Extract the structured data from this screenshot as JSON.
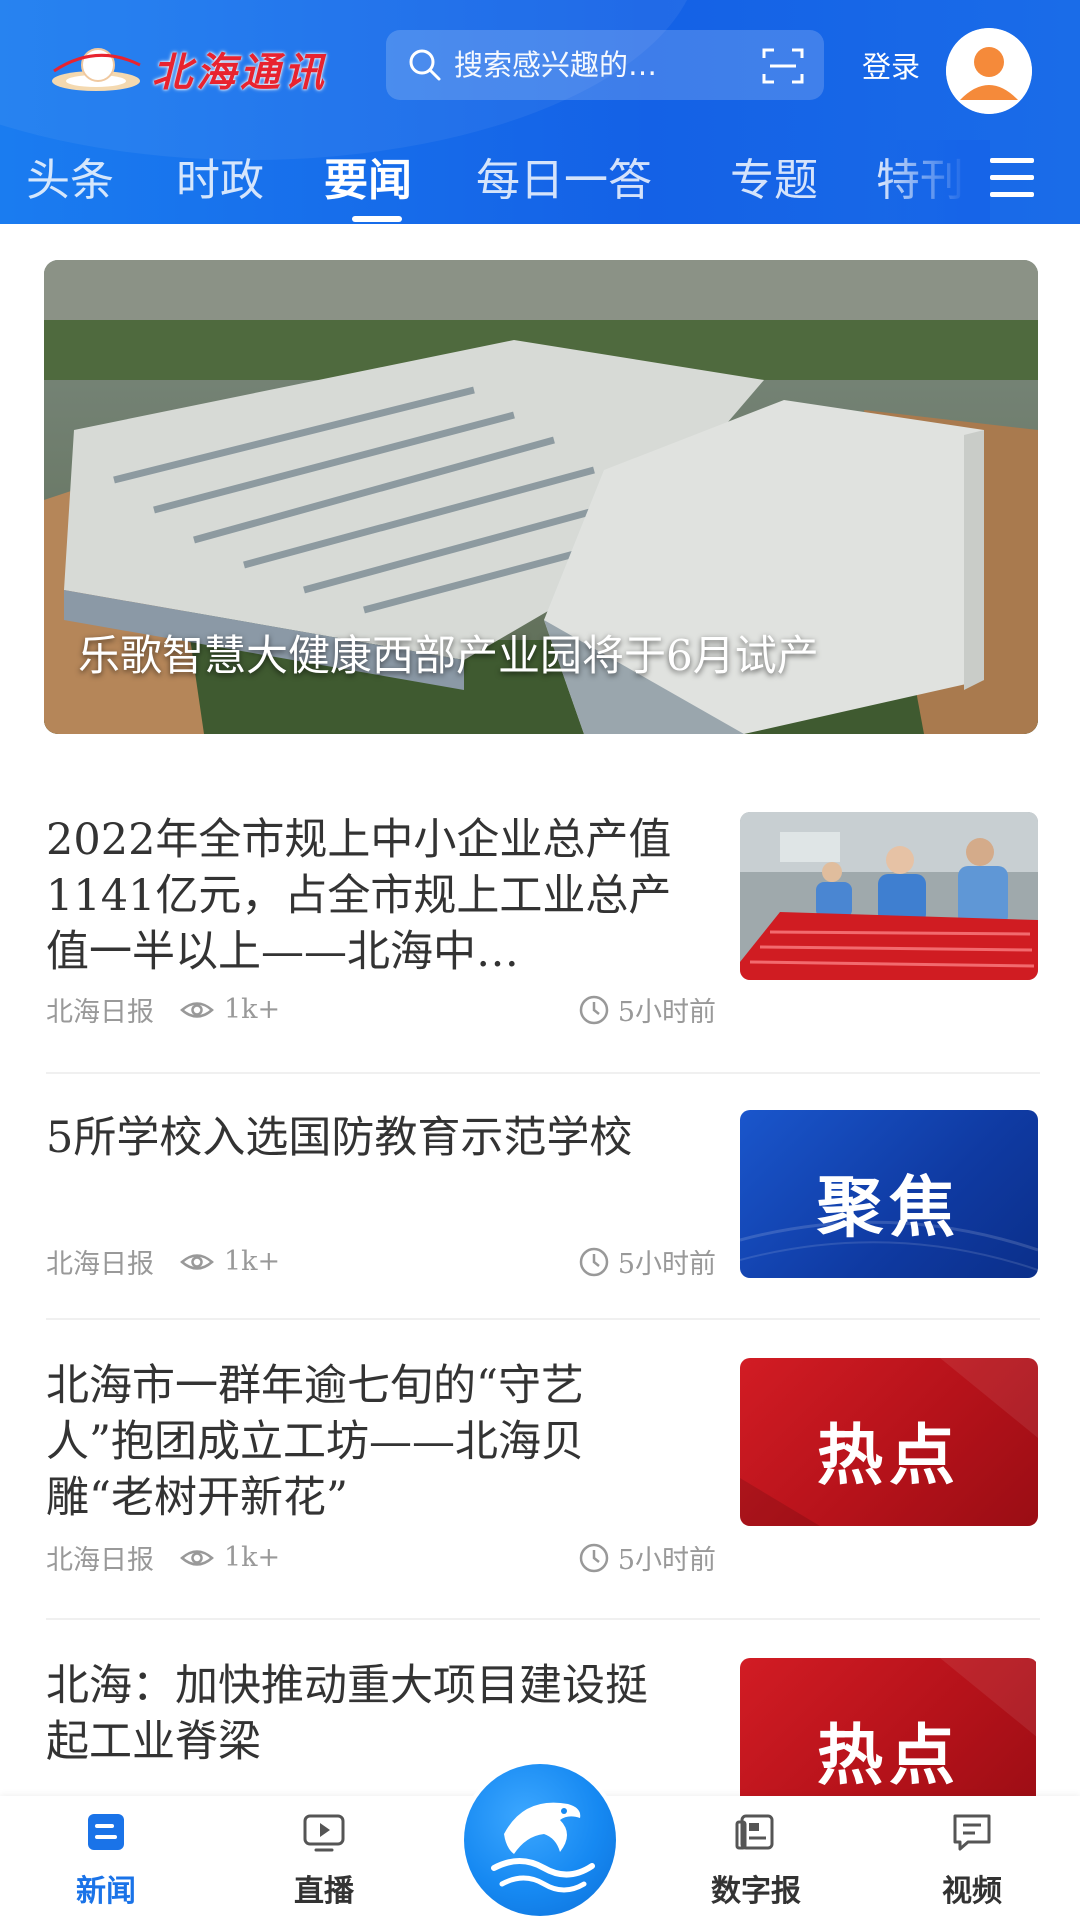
{
  "header": {
    "logo_text": "北海通讯",
    "search_placeholder": "搜索感兴趣的…",
    "login_label": "登录"
  },
  "tabs": [
    {
      "label": "头条"
    },
    {
      "label": "时政"
    },
    {
      "label": "要闻",
      "active": true
    },
    {
      "label": "每日一答"
    },
    {
      "label": "专题"
    },
    {
      "label": "特刊"
    }
  ],
  "hero": {
    "caption": "乐歌智慧大健康西部产业园将于6月试产"
  },
  "news": [
    {
      "title": "2022年全市规上中小企业总产值1141亿元，占全市规上工业总产值一半以上——北海中…",
      "source": "北海日报",
      "views": "1k+",
      "time": "5小时前",
      "thumb": "photo"
    },
    {
      "title": "5所学校入选国防教育示范学校",
      "source": "北海日报",
      "views": "1k+",
      "time": "5小时前",
      "thumb": "聚焦"
    },
    {
      "title": "北海市一群年逾七旬的“守艺人”抱团成立工坊——北海贝雕“老树开新花”",
      "source": "北海日报",
      "views": "1k+",
      "time": "5小时前",
      "thumb": "热点"
    },
    {
      "title": "北海：加快推动重大项目建设挺起工业脊梁",
      "thumb": "热点"
    }
  ],
  "bottom_nav": [
    {
      "label": "新闻",
      "icon": "news-icon",
      "active": true
    },
    {
      "label": "直播",
      "icon": "live-tv-icon"
    },
    {
      "label": "数字报",
      "icon": "digital-paper-icon"
    },
    {
      "label": "视频",
      "icon": "video-chat-icon"
    }
  ],
  "colors": {
    "header_blue": "#1461e6",
    "accent_blue": "#1a73e8",
    "logo_red": "#e8232f",
    "focus_blue": "#1a4fc0",
    "hot_red": "#c8141c"
  }
}
